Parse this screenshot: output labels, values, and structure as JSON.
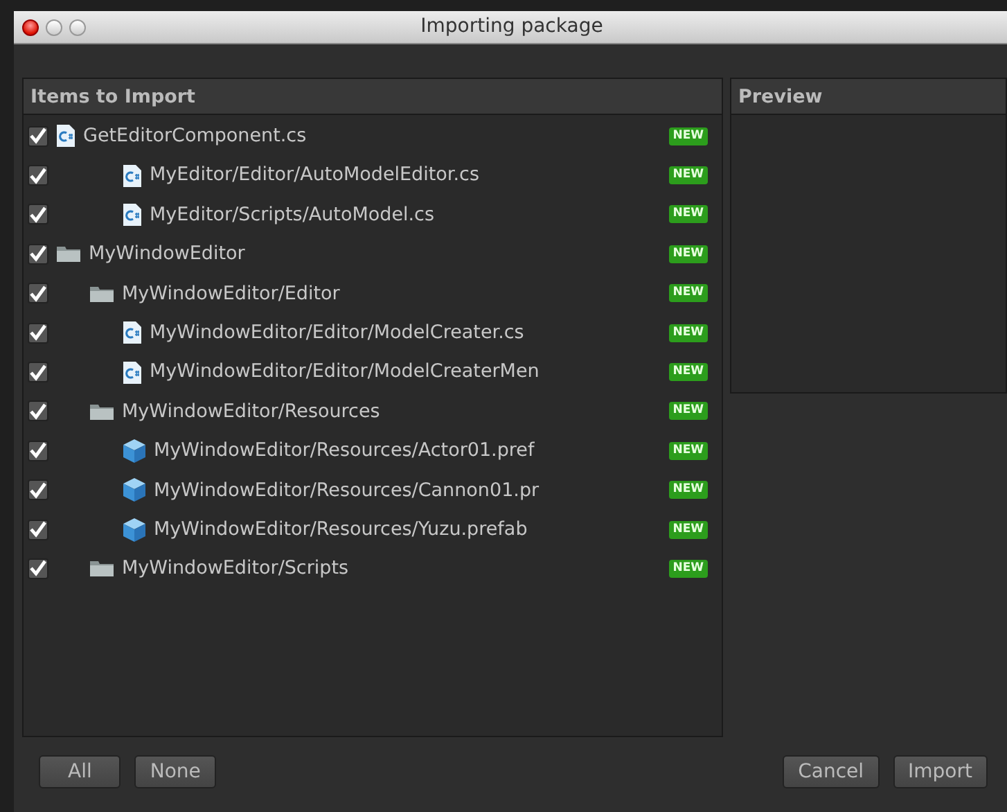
{
  "window": {
    "title": "Importing package"
  },
  "items_panel": {
    "title": "Items to Import",
    "items": [
      {
        "label": "GetEditorComponent.cs",
        "kind": "script",
        "checked": true,
        "badge": "NEW"
      },
      {
        "children": [
          {
            "children": [
              {
                "label": "MyEditor/Editor/AutoModelEditor.cs",
                "kind": "script",
                "checked": true,
                "badge": "NEW"
              },
              {
                "label": "MyEditor/Scripts/AutoModel.cs",
                "kind": "script",
                "checked": true,
                "badge": "NEW"
              }
            ]
          }
        ]
      },
      {
        "label": "MyWindowEditor",
        "kind": "folder",
        "checked": true,
        "badge": "NEW",
        "children": [
          {
            "label": "MyWindowEditor/Editor",
            "kind": "folder",
            "checked": true,
            "badge": "NEW",
            "children": [
              {
                "label": "MyWindowEditor/Editor/ModelCreater.cs",
                "kind": "script",
                "checked": true,
                "badge": "NEW"
              },
              {
                "label": "MyWindowEditor/Editor/ModelCreaterMen",
                "kind": "script",
                "checked": true,
                "badge": "NEW"
              }
            ]
          },
          {
            "label": "MyWindowEditor/Resources",
            "kind": "folder",
            "checked": true,
            "badge": "NEW",
            "children": [
              {
                "label": "MyWindowEditor/Resources/Actor01.pref",
                "kind": "prefab",
                "checked": true,
                "badge": "NEW"
              },
              {
                "label": "MyWindowEditor/Resources/Cannon01.pr",
                "kind": "prefab",
                "checked": true,
                "badge": "NEW"
              },
              {
                "label": "MyWindowEditor/Resources/Yuzu.prefab",
                "kind": "prefab",
                "checked": true,
                "badge": "NEW"
              }
            ]
          },
          {
            "label": "MyWindowEditor/Scripts",
            "kind": "folder",
            "checked": true,
            "badge": "NEW"
          }
        ]
      }
    ]
  },
  "preview_panel": {
    "title": "Preview"
  },
  "buttons_left": [
    "All",
    "None"
  ],
  "buttons_right": [
    "Cancel",
    "Import"
  ]
}
